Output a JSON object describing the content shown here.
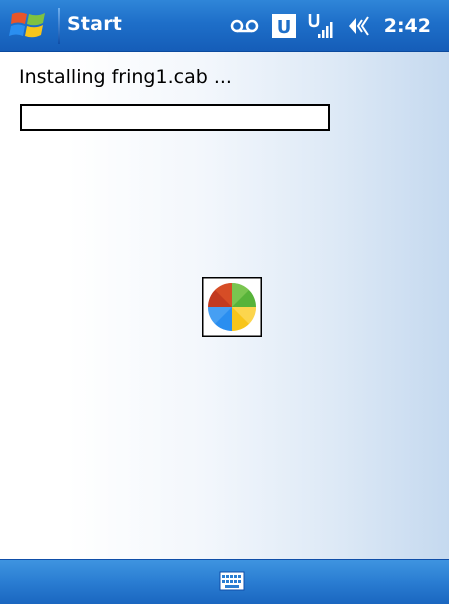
{
  "titlebar": {
    "title": "Start",
    "clock": "2:42",
    "icons": [
      "windows-start-icon",
      "voicemail-icon",
      "u-badge-icon",
      "signal-icon",
      "speaker-icon"
    ],
    "u_badge": "U"
  },
  "content": {
    "status": "Installing fring1.cab ...",
    "progress": 0
  },
  "menubar": {
    "icons": [
      "keyboard-icon"
    ]
  },
  "colors": {
    "titlebar": "#1e6fc9",
    "menubar": "#2a7dd2",
    "background_edge": "#c5d9ef"
  }
}
